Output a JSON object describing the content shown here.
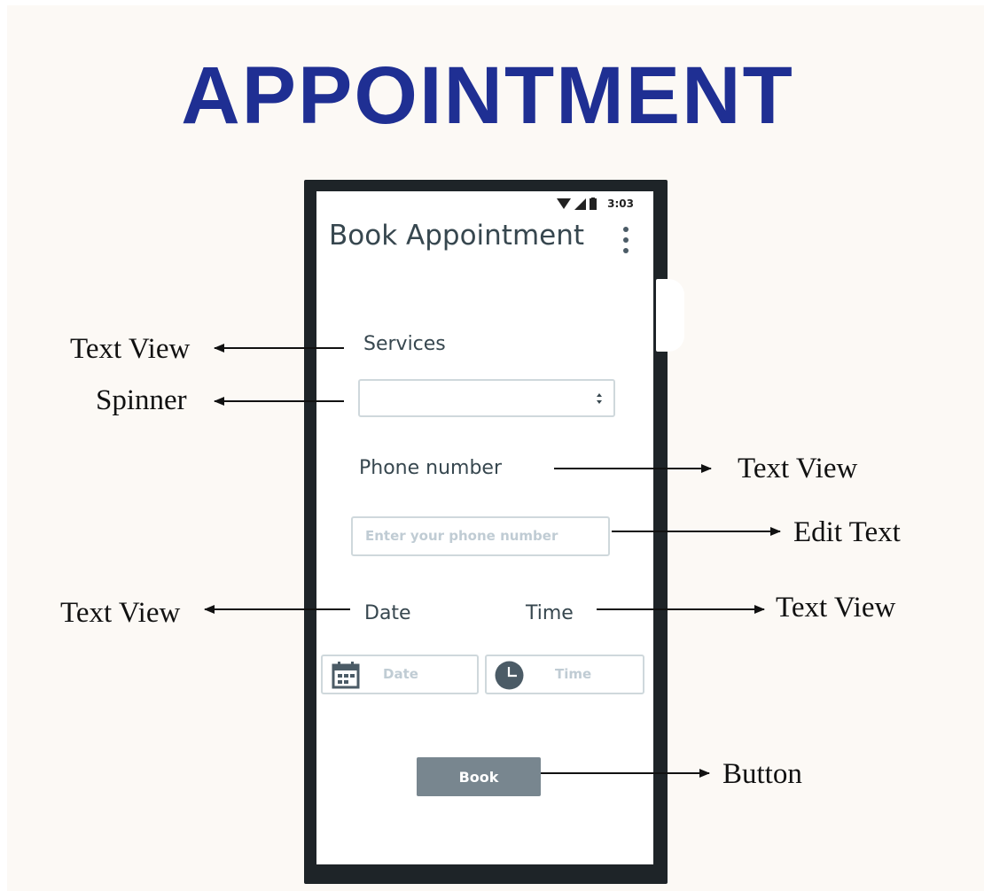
{
  "title": "APPOINTMENT",
  "phone": {
    "status_time": "3:03",
    "app_title": "Book Appointment",
    "services_label": "Services",
    "phone_label": "Phone number",
    "phone_placeholder": "Enter your phone number",
    "date_label": "Date",
    "time_label": "Time",
    "date_placeholder": "Date",
    "time_placeholder": "Time",
    "book_label": "Book"
  },
  "annotations": {
    "services": "Text View",
    "spinner": "Spinner",
    "phone_label": "Text View",
    "edit_text": "Edit Text",
    "date": "Text View",
    "time": "Text View",
    "button": "Button"
  },
  "icons": [
    "wifi-icon",
    "signal-icon",
    "battery-icon",
    "more-vert-icon",
    "spinner-arrows-icon",
    "calendar-icon",
    "clock-icon"
  ],
  "colors": {
    "title": "#1f2f93",
    "phone_frame": "#1e2428",
    "book_button": "#78868f",
    "background": "#fcf9f5"
  }
}
